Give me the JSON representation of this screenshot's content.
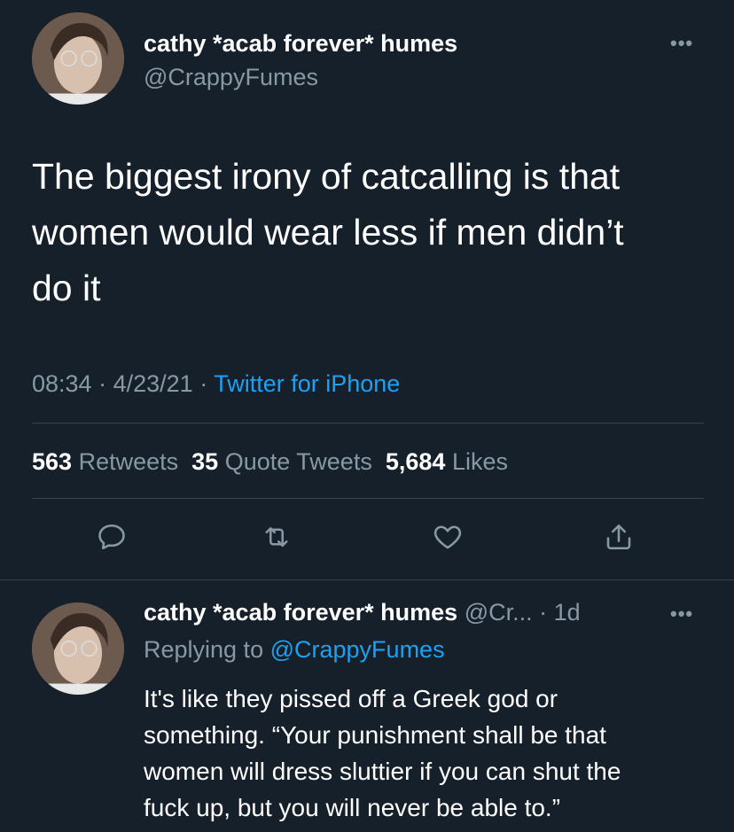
{
  "main_tweet": {
    "author_name": "cathy *acab forever* humes",
    "author_handle": "@CrappyFumes",
    "more_label": "•••",
    "lines": [
      "The biggest irony of catcalling is that",
      "women would wear less if men didn’t",
      "do it"
    ],
    "time": "08:34",
    "date": "4/23/21",
    "source": "Twitter for iPhone",
    "separator": "·",
    "stats": {
      "retweets_count": "563",
      "retweets_label": "Retweets",
      "quotes_count": "35",
      "quotes_label": "Quote Tweets",
      "likes_count": "5,684",
      "likes_label": "Likes"
    }
  },
  "actions": [
    {
      "name": "reply",
      "icon": "comment-icon"
    },
    {
      "name": "retweet",
      "icon": "retweet-icon"
    },
    {
      "name": "like",
      "icon": "heart-icon"
    },
    {
      "name": "share",
      "icon": "share-icon"
    }
  ],
  "reply_tweet": {
    "author_name": "cathy *acab forever* humes",
    "author_handle_truncated": "@Cr...",
    "separator": "·",
    "age": "1d",
    "more_label": "•••",
    "replying_prefix": "Replying to",
    "replying_to": "@CrappyFumes",
    "lines": [
      "It's like they pissed off a Greek god or",
      "something. “Your punishment shall be that",
      "women will dress sluttier if you can shut the",
      "fuck up, but you will never be able to.”"
    ]
  },
  "colors": {
    "background": "#15202b",
    "secondary_text": "#8899a6",
    "accent": "#1da1f2",
    "divider": "#38444d"
  }
}
